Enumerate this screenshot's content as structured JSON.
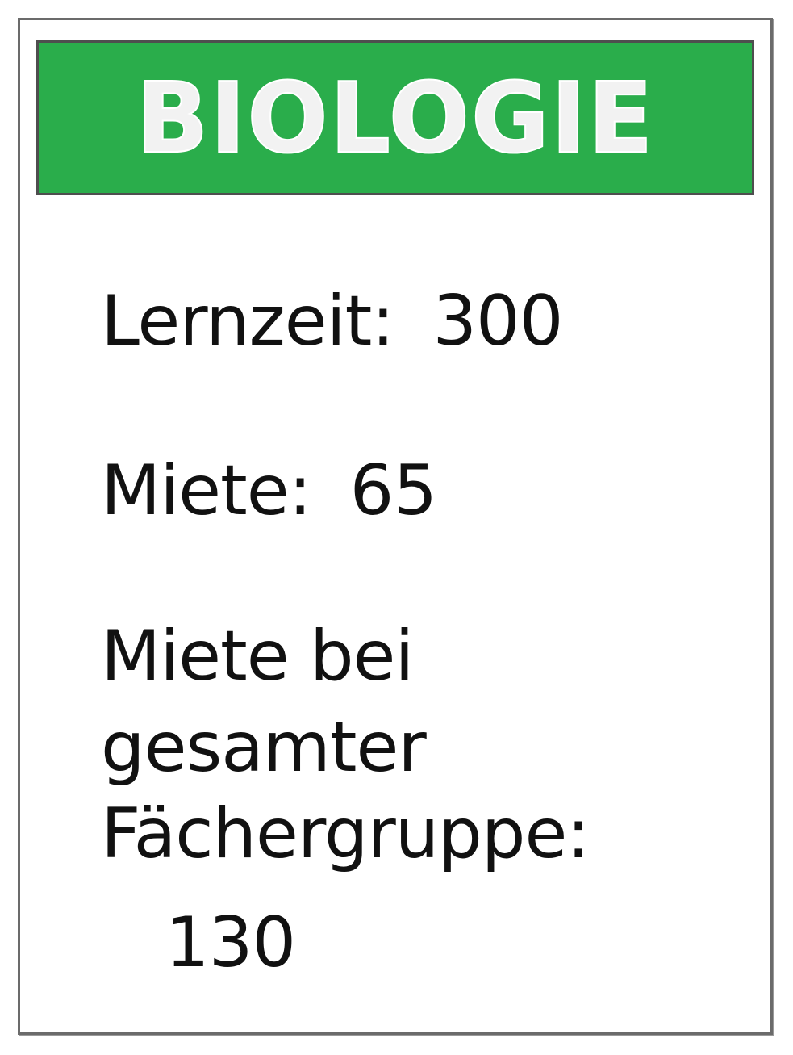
{
  "card": {
    "title": "BIOLOGIE",
    "header_color": "#2aad4b",
    "lernzeit_label": "Lernzeit:",
    "lernzeit_value": "300",
    "miete_label": "Miete:",
    "miete_value": "65",
    "miete_gesamt_label_line1": "Miete bei",
    "miete_gesamt_label_line2": "gesamter",
    "miete_gesamt_label_line3": "Fächergruppe:",
    "miete_gesamt_value": "130"
  }
}
